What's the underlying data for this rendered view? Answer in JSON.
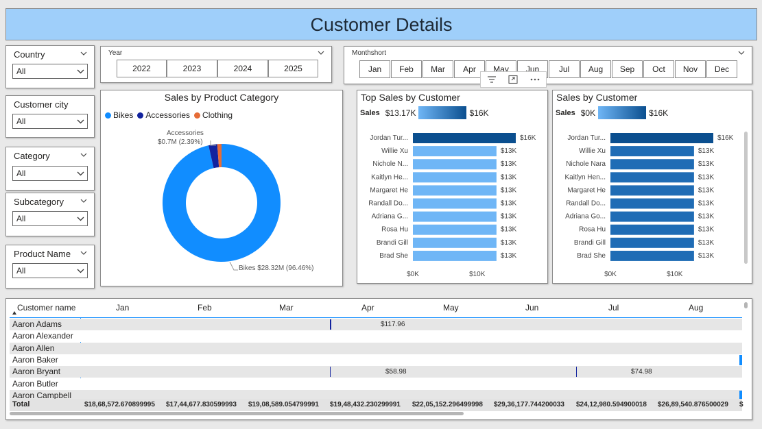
{
  "header": {
    "title": "Customer Details"
  },
  "slicers": {
    "country": {
      "title": "Country",
      "value": "All"
    },
    "city": {
      "title": "Customer city",
      "value": "All"
    },
    "category": {
      "title": "Category",
      "value": "All"
    },
    "subcategory": {
      "title": "Subcategory",
      "value": "All"
    },
    "product": {
      "title": "Product Name",
      "value": "All"
    },
    "year": {
      "title": "Year",
      "options": [
        "2022",
        "2023",
        "2024",
        "2025"
      ]
    },
    "month": {
      "title": "Monthshort",
      "options": [
        "Jan",
        "Feb",
        "Mar",
        "Apr",
        "May",
        "Jun",
        "Jul",
        "Aug",
        "Sep",
        "Oct",
        "Nov",
        "Dec"
      ]
    }
  },
  "donut": {
    "title": "Sales by Product Category",
    "legend": [
      "Bikes",
      "Accessories",
      "Clothing"
    ],
    "label_accessories_name": "Accessories",
    "label_accessories_value": "$0.7M (2.39%)",
    "label_bikes": "Bikes $28.32M (96.46%)"
  },
  "top_sales": {
    "title": "Top Sales by Customer",
    "legend_label": "Sales",
    "legend_min": "$13.17K",
    "legend_max": "$16K",
    "ticks": [
      "$0K",
      "$10K"
    ]
  },
  "sales_by_customer": {
    "title": "Sales by Customer",
    "legend_label": "Sales",
    "legend_min": "$0K",
    "legend_max": "$16K",
    "ticks": [
      "$0K",
      "$10K"
    ]
  },
  "matrix": {
    "col_header": "Customer name",
    "months": [
      "Jan",
      "Feb",
      "Mar",
      "Apr",
      "May",
      "Jun",
      "Jul",
      "Aug"
    ],
    "rows": [
      "Aaron Adams",
      "Aaron Alexander",
      "Aaron Allen",
      "Aaron Baker",
      "Aaron Bryant",
      "Aaron Butler",
      "Aaron Campbell"
    ],
    "cell_adams_apr": "$117.96",
    "cell_bryant_apr": "$58.98",
    "cell_bryant_jul": "$74.98",
    "total_label": "Total",
    "totals": [
      "$18,68,572.670899995",
      "$17,44,677.830599993",
      "$19,08,589.054799991",
      "$19,48,432.230299991",
      "$22,05,152.296499998",
      "$29,36,177.744200033",
      "$24,12,980.594900018",
      "$26,89,540.876500029",
      "$"
    ]
  },
  "chart_data": [
    {
      "type": "pie",
      "title": "Sales by Product Category",
      "categories": [
        "Bikes",
        "Accessories",
        "Clothing"
      ],
      "values": [
        28.32,
        0.7,
        0.34
      ],
      "percent": [
        96.46,
        2.39,
        1.15
      ],
      "colors": [
        "#118dff",
        "#12239e",
        "#e66c37"
      ]
    },
    {
      "type": "bar",
      "title": "Top Sales by Customer",
      "categories": [
        "Jordan Tur...",
        "Willie Xu",
        "Nichole N...",
        "Kaitlyn He...",
        "Margaret He",
        "Randall Do...",
        "Adriana G...",
        "Rosa Hu",
        "Brandi Gill",
        "Brad She"
      ],
      "values": [
        16,
        13,
        13,
        13,
        13,
        13,
        13,
        13,
        13,
        13
      ],
      "labels": [
        "$16K",
        "$13K",
        "$13K",
        "$13K",
        "$13K",
        "$13K",
        "$13K",
        "$13K",
        "$13K",
        "$13K"
      ],
      "xlim": [
        0,
        16
      ]
    },
    {
      "type": "bar",
      "title": "Sales by Customer",
      "categories": [
        "Jordan Tur...",
        "Willie Xu",
        "Nichole Nara",
        "Kaitlyn Hen...",
        "Margaret He",
        "Randall Do...",
        "Adriana Go...",
        "Rosa Hu",
        "Brandi Gill",
        "Brad She"
      ],
      "values": [
        16,
        13,
        13,
        13,
        13,
        13,
        13,
        13,
        13,
        13
      ],
      "labels": [
        "$16K",
        "$13K",
        "$13K",
        "$13K",
        "$13K",
        "$13K",
        "$13K",
        "$13K",
        "$13K",
        "$13K"
      ],
      "xlim": [
        0,
        16
      ]
    }
  ]
}
